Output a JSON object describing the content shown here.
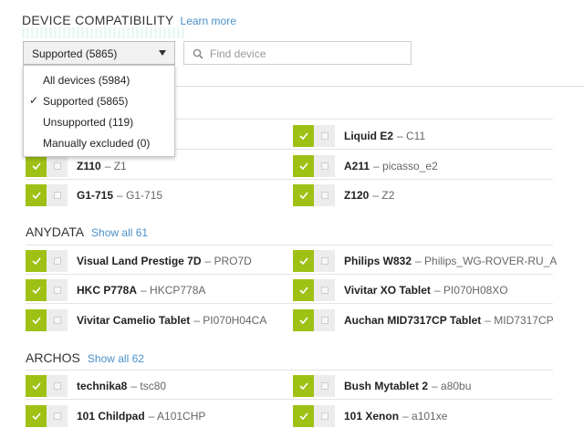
{
  "header": {
    "title": "DEVICE COMPATIBILITY",
    "learn_more": "Learn more"
  },
  "filter": {
    "selected": "Supported (5865)",
    "options": [
      {
        "label": "All devices (5984)",
        "checked": false
      },
      {
        "label": "Supported (5865)",
        "checked": true
      },
      {
        "label": "Unsupported (119)",
        "checked": false
      },
      {
        "label": "Manually excluded (0)",
        "checked": false
      }
    ]
  },
  "search": {
    "placeholder": "Find device",
    "value": ""
  },
  "groups": [
    {
      "name": "",
      "show_all": "",
      "devices": [
        {
          "name": "",
          "model": ""
        },
        {
          "name": "Liquid E2",
          "model": "– C11"
        },
        {
          "name": "Z110",
          "model": "– Z1"
        },
        {
          "name": "A211",
          "model": "– picasso_e2"
        },
        {
          "name": "G1-715",
          "model": "– G1-715"
        },
        {
          "name": "Z120",
          "model": "– Z2"
        }
      ]
    },
    {
      "name": "ANYDATA",
      "show_all": "Show all 61",
      "devices": [
        {
          "name": "Visual Land Prestige 7D",
          "model": "– PRO7D"
        },
        {
          "name": "Philips W832",
          "model": "– Philips_WG-ROVER-RU_A"
        },
        {
          "name": "HKC P778A",
          "model": "– HKCP778A"
        },
        {
          "name": "Vivitar XO Tablet",
          "model": "– PI070H08XO"
        },
        {
          "name": "Vivitar Camelio Tablet",
          "model": "– PI070H04CA"
        },
        {
          "name": "Auchan MID7317CP Tablet",
          "model": "– MID7317CP"
        }
      ]
    },
    {
      "name": "ARCHOS",
      "show_all": "Show all 62",
      "devices": [
        {
          "name": "technika8",
          "model": "– tsc80"
        },
        {
          "name": "Bush Mytablet 2",
          "model": "– a80bu"
        },
        {
          "name": "101 Childpad",
          "model": "– A101CHP"
        },
        {
          "name": "101 Xenon",
          "model": "– a101xe"
        }
      ]
    }
  ],
  "colors": {
    "accent": "#9fc115",
    "link": "#4a90c9"
  }
}
